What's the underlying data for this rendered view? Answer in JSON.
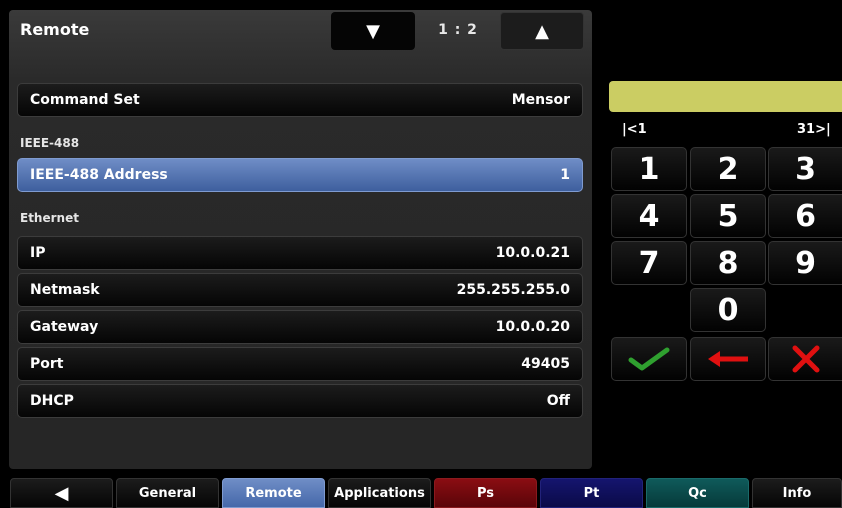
{
  "header": {
    "title": "Remote",
    "page_indicator": "1 : 2",
    "page_down_icon": "▼",
    "page_up_icon": "▲"
  },
  "settings": {
    "command_set": {
      "label": "Command Set",
      "value": "Mensor"
    },
    "ieee_section": "IEEE-488",
    "ieee_address": {
      "label": "IEEE-488 Address",
      "value": "1"
    },
    "ethernet_section": "Ethernet",
    "ip": {
      "label": "IP",
      "value": "10.0.0.21"
    },
    "netmask": {
      "label": "Netmask",
      "value": "255.255.255.0"
    },
    "gateway": {
      "label": "Gateway",
      "value": "10.0.0.20"
    },
    "port": {
      "label": "Port",
      "value": "49405"
    },
    "dhcp": {
      "label": "DHCP",
      "value": "Off"
    }
  },
  "keypad": {
    "display_value": "",
    "range_min": "|<1",
    "range_max": "31>|",
    "keys": [
      "1",
      "2",
      "3",
      "4",
      "5",
      "6",
      "7",
      "8",
      "9",
      "0"
    ],
    "colors": {
      "display": "#cbcd63",
      "accept": "#2fa02f",
      "backspace": "#e01010",
      "cancel": "#e01010"
    }
  },
  "tabs": {
    "back_icon": "◀",
    "general": "General",
    "remote": "Remote",
    "applications": "Applications",
    "ps": "Ps",
    "pt": "Pt",
    "qc": "Qc",
    "info": "Info"
  }
}
